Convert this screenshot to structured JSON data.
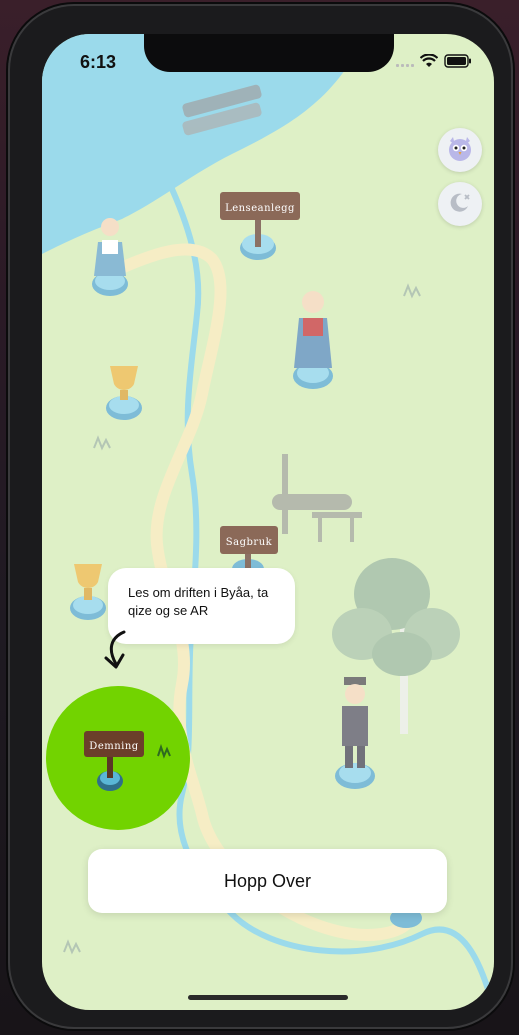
{
  "status_bar": {
    "time": "6:13"
  },
  "map": {
    "signs": {
      "lenseanlegg": "Lenseanlegg",
      "sagbruk": "Sagbruk",
      "demning": "Demning"
    }
  },
  "tooltip": {
    "text": "Les om driften i Byåa, ta qize og se AR"
  },
  "skip_button": {
    "label": "Hopp Over"
  },
  "icons": {
    "profile": "owl-avatar-icon",
    "night_mode": "moon-icon",
    "arrow": "curved-arrow-down-icon"
  },
  "colors": {
    "grass": "#d5ecb6",
    "water": "#7fd0e6",
    "path": "#f4e8b5",
    "highlight": "#72d300",
    "sign_wood": "#6b3f2a"
  }
}
